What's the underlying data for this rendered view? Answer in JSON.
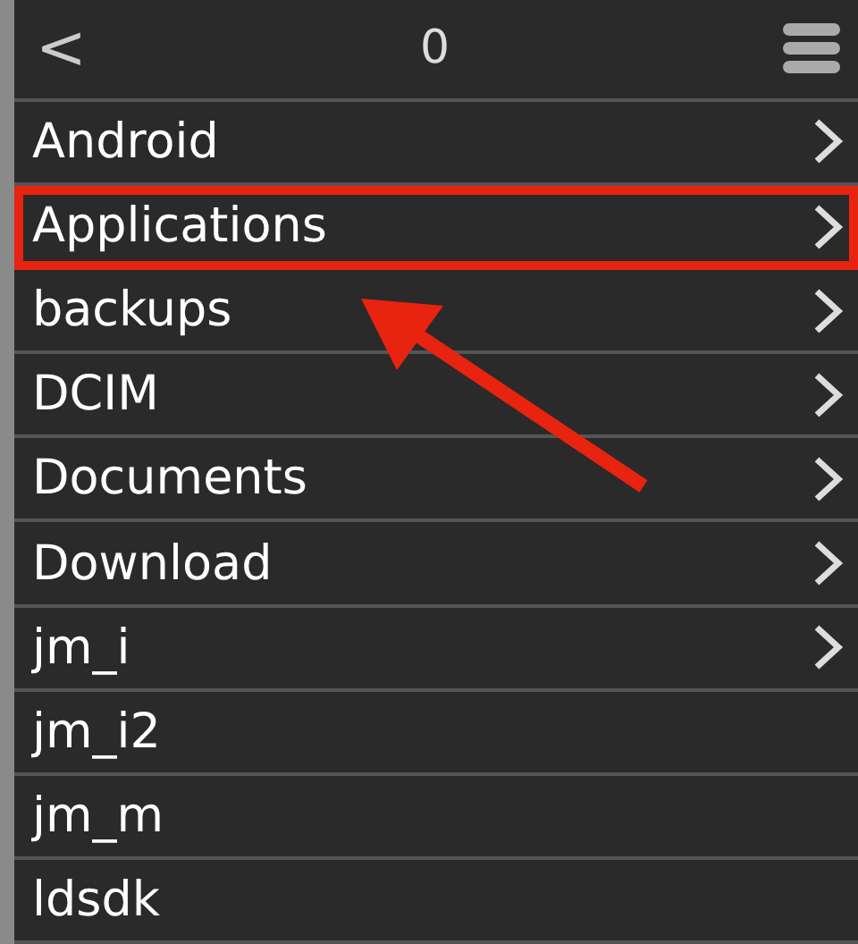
{
  "header": {
    "back": "<",
    "title": "0"
  },
  "folders": [
    {
      "name": "Android",
      "chevron": true,
      "highlighted": false
    },
    {
      "name": "Applications",
      "chevron": true,
      "highlighted": true
    },
    {
      "name": "backups",
      "chevron": true,
      "highlighted": false
    },
    {
      "name": "DCIM",
      "chevron": true,
      "highlighted": false
    },
    {
      "name": "Documents",
      "chevron": true,
      "highlighted": false
    },
    {
      "name": "Download",
      "chevron": true,
      "highlighted": false
    },
    {
      "name": "jm_i",
      "chevron": true,
      "highlighted": false
    },
    {
      "name": "jm_i2",
      "chevron": false,
      "highlighted": false
    },
    {
      "name": "jm_m",
      "chevron": false,
      "highlighted": false
    },
    {
      "name": "ldsdk",
      "chevron": false,
      "highlighted": false
    }
  ]
}
